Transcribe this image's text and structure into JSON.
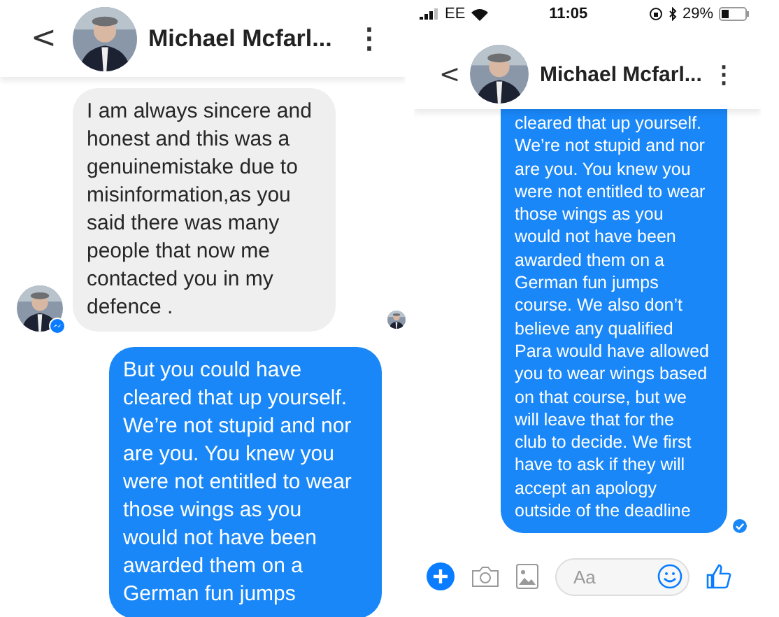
{
  "screens": [
    {
      "header": {
        "back": "<",
        "name": "Michael Mcfarl...",
        "menu": "⋮"
      },
      "messages": [
        {
          "kind": "received",
          "lines": [
            "I am always sincere and",
            "honest and this was a",
            "genuinemistake due to",
            "misinformation,as you",
            "said there was many",
            "people that now me",
            "contacted you in my",
            "defence ."
          ],
          "seen_avatar": true
        },
        {
          "kind": "sent",
          "lines": [
            "But you could have",
            "cleared that up yourself.",
            "We’re not stupid and nor",
            "are you. You knew you",
            "were not entitled to wear",
            "those wings as you",
            "would not have been",
            "awarded them on a",
            "German fun jumps"
          ]
        }
      ]
    },
    {
      "status_bar": {
        "carrier": "EE",
        "time": "11:05",
        "battery": "29%"
      },
      "header": {
        "back": "<",
        "name": "Michael Mcfarl...",
        "menu": "⋮"
      },
      "messages": [
        {
          "kind": "sent",
          "lines": [
            "cleared that up yourself.",
            "We’re not stupid and nor",
            "are you. You knew you",
            "were not entitled to wear",
            "those wings as you",
            "would not have been",
            "awarded them on a",
            "German fun jumps",
            "course. We also don’t",
            "believe any qualified",
            "Para would have allowed",
            "you to wear wings based",
            "on that course, but we",
            "will leave that for the",
            "club to decide. We first",
            "have to ask if they will",
            "accept an apology",
            "outside of the deadline"
          ],
          "delivered": true
        }
      ],
      "composer": {
        "placeholder": "Aa"
      }
    }
  ]
}
